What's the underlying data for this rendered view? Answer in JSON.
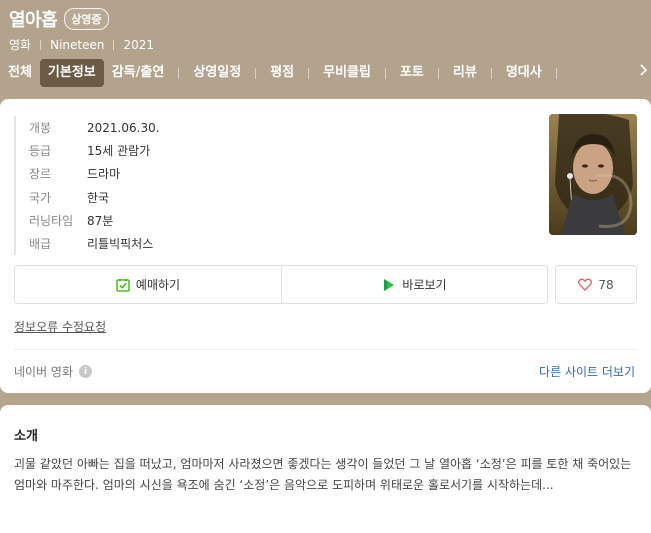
{
  "header": {
    "title": "열아홉",
    "badge": "상영중",
    "meta": [
      "영화",
      "Nineteen",
      "2021"
    ]
  },
  "tabs": [
    {
      "label": "전체",
      "active": false
    },
    {
      "label": "기본정보",
      "active": true
    },
    {
      "label": "감독/출연",
      "active": false
    },
    {
      "label": "상영일정",
      "active": false
    },
    {
      "label": "평점",
      "active": false
    },
    {
      "label": "무비클립",
      "active": false
    },
    {
      "label": "포토",
      "active": false
    },
    {
      "label": "리뷰",
      "active": false
    },
    {
      "label": "명대사",
      "active": false
    }
  ],
  "info": [
    {
      "label": "개봉",
      "value": "2021.06.30."
    },
    {
      "label": "등급",
      "value": "15세 관람가"
    },
    {
      "label": "장르",
      "value": "드라마"
    },
    {
      "label": "국가",
      "value": "한국"
    },
    {
      "label": "러닝타임",
      "value": "87분"
    },
    {
      "label": "배급",
      "value": "리틀빅픽처스"
    }
  ],
  "actions": {
    "reserve_label": "예매하기",
    "watch_label": "바로보기",
    "like_count": "78"
  },
  "report_link": "정보오류 수정요청",
  "source": {
    "label": "네이버 영화",
    "more_link": "다른 사이트 더보기"
  },
  "intro": {
    "title": "소개",
    "text": "괴물 같았던 아빠는 집을 떠났고, 엄마마저 사라졌으면 좋겠다는 생각이 들었던 그 날 열아홉 ‘소정’은 피를 토한 채 죽어있는 엄마와 마주한다. 엄마의 시신을 욕조에 숨긴 ‘소정’은 음악으로 도피하며 위태로운 홀로서기를 시작하는데..."
  },
  "colors": {
    "header_bg": "#b3a38d",
    "active_tab_bg": "#6b5a44",
    "link_blue": "#2f6bbf",
    "like_heart": "#e0606a",
    "reserve_green": "#2db400"
  }
}
